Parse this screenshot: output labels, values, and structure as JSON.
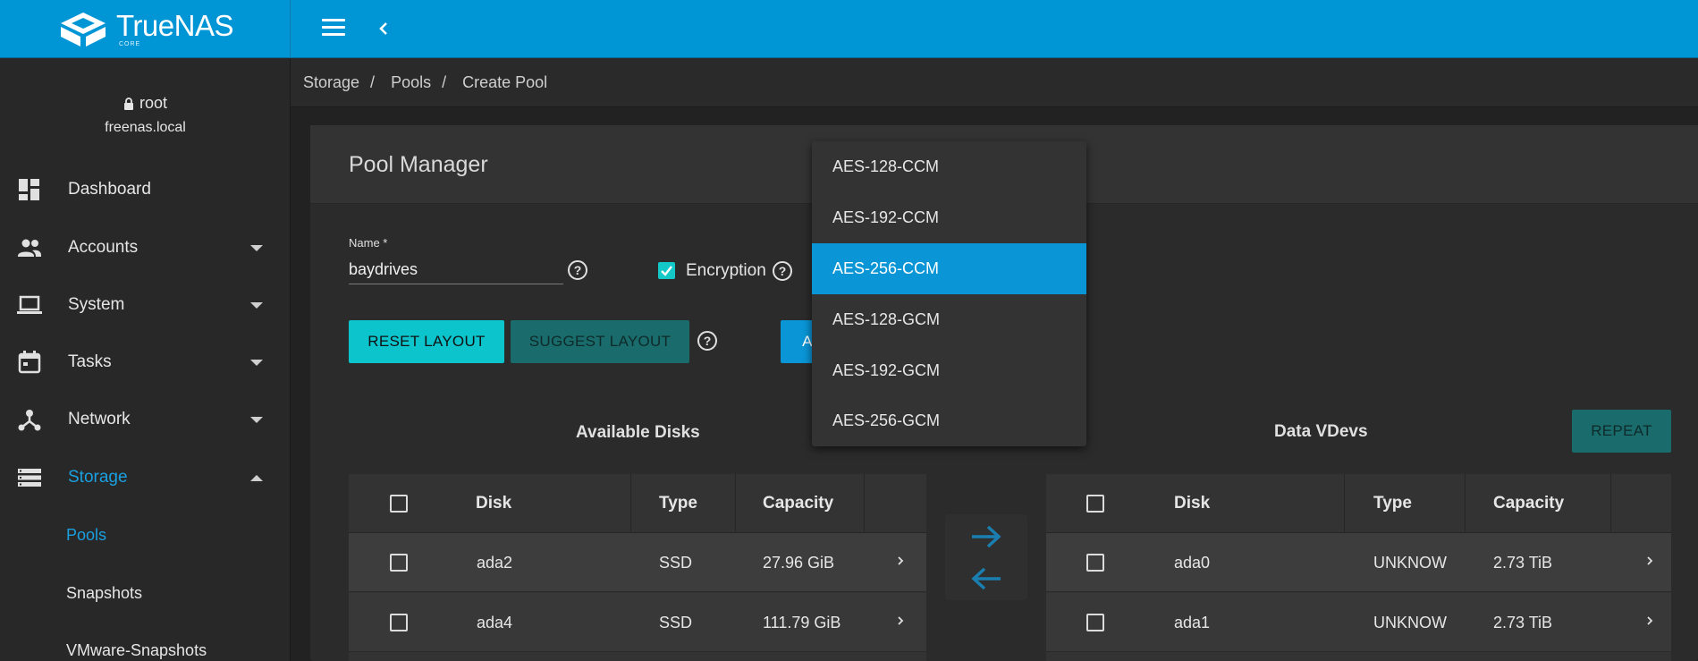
{
  "app": {
    "brand": "TrueNAS",
    "brand_sub": "CORE"
  },
  "user": {
    "name": "root",
    "host": "freenas.local"
  },
  "sidebar": {
    "items": [
      {
        "label": "Dashboard",
        "icon": "dashboard-icon"
      },
      {
        "label": "Accounts",
        "icon": "people-icon"
      },
      {
        "label": "System",
        "icon": "laptop-icon"
      },
      {
        "label": "Tasks",
        "icon": "calendar-icon"
      },
      {
        "label": "Network",
        "icon": "network-icon"
      },
      {
        "label": "Storage",
        "icon": "storage-icon"
      }
    ],
    "sub_items": [
      {
        "label": "Pools"
      },
      {
        "label": "Snapshots"
      },
      {
        "label": "VMware-Snapshots"
      }
    ]
  },
  "breadcrumb": [
    "Storage",
    "Pools",
    "Create Pool"
  ],
  "breadcrumb_sep": "/",
  "pool_manager": {
    "title": "Pool Manager",
    "name_label": "Name *",
    "name_value": "baydrives",
    "encryption_label": "Encryption",
    "encryption_checked": true,
    "reset_label": "RESET LAYOUT",
    "suggest_label": "SUGGEST LAYOUT",
    "hidden_button_label": "A",
    "repeat_label": "REPEAT",
    "help_glyph": "?"
  },
  "encryption_dropdown": {
    "options": [
      "AES-128-CCM",
      "AES-192-CCM",
      "AES-256-CCM",
      "AES-128-GCM",
      "AES-192-GCM",
      "AES-256-GCM"
    ],
    "selected": "AES-256-CCM"
  },
  "available_disks": {
    "title": "Available Disks",
    "columns": [
      "Disk",
      "Type",
      "Capacity"
    ],
    "rows": [
      {
        "disk": "ada2",
        "type": "SSD",
        "capacity": "27.96 GiB"
      },
      {
        "disk": "ada4",
        "type": "SSD",
        "capacity": "111.79 GiB"
      }
    ]
  },
  "data_vdevs": {
    "title": "Data VDevs",
    "columns": [
      "Disk",
      "Type",
      "Capacity"
    ],
    "rows": [
      {
        "disk": "ada0",
        "type": "UNKNOW",
        "capacity": "2.73 TiB"
      },
      {
        "disk": "ada1",
        "type": "UNKNOW",
        "capacity": "2.73 TiB"
      }
    ]
  },
  "colors": {
    "accent": "#0095d5",
    "teal": "#0bc4cc",
    "background": "#222222"
  }
}
